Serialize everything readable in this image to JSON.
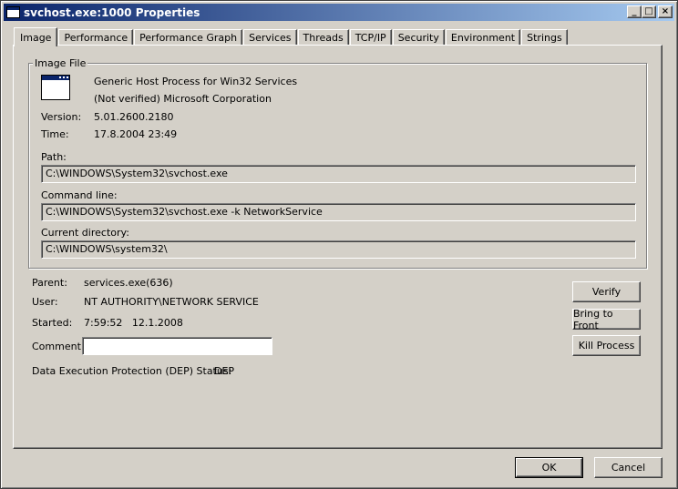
{
  "window": {
    "title": "svchost.exe:1000 Properties"
  },
  "tabs": [
    {
      "label": "Image"
    },
    {
      "label": "Performance"
    },
    {
      "label": "Performance Graph"
    },
    {
      "label": "Services"
    },
    {
      "label": "Threads"
    },
    {
      "label": "TCP/IP"
    },
    {
      "label": "Security"
    },
    {
      "label": "Environment"
    },
    {
      "label": "Strings"
    }
  ],
  "image_file": {
    "group_title": "Image File",
    "description": "Generic Host Process for Win32 Services",
    "company": "(Not verified) Microsoft Corporation",
    "version_label": "Version:",
    "version": "5.01.2600.2180",
    "time_label": "Time:",
    "time": "17.8.2004 23:49",
    "path_label": "Path:",
    "path": "C:\\WINDOWS\\System32\\svchost.exe",
    "cmdline_label": "Command line:",
    "cmdline": "C:\\WINDOWS\\System32\\svchost.exe -k NetworkService",
    "curdir_label": "Current directory:",
    "curdir": "C:\\WINDOWS\\system32\\"
  },
  "process": {
    "parent_label": "Parent:",
    "parent": "services.exe(636)",
    "user_label": "User:",
    "user": "NT AUTHORITY\\NETWORK SERVICE",
    "started_label": "Started:",
    "started": "7:59:52   12.1.2008",
    "comment_label": "Comment:",
    "comment_value": "",
    "dep_label": "Data Execution Protection (DEP) Status:",
    "dep": "DEP"
  },
  "actions": {
    "verify": "Verify",
    "bring_to_front": "Bring to Front",
    "kill": "Kill Process"
  },
  "footer": {
    "ok": "OK",
    "cancel": "Cancel"
  },
  "title_buttons": {
    "minimize": "_",
    "maximize": "□",
    "close": "×"
  }
}
